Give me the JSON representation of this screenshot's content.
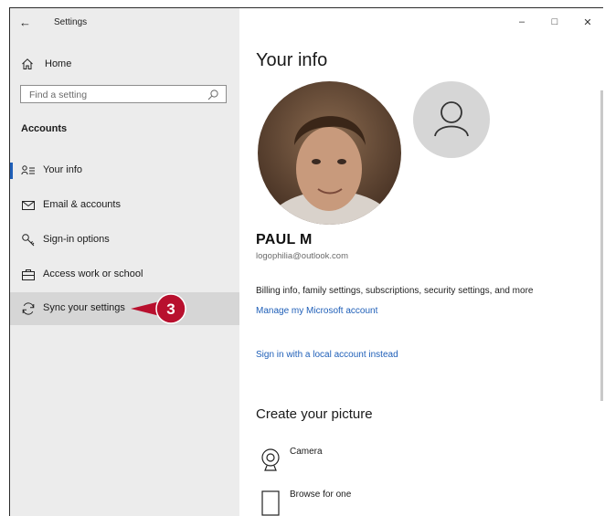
{
  "window": {
    "title": "Settings",
    "back_glyph": "←",
    "minimize_glyph": "–",
    "maximize_glyph": "□",
    "close_glyph": "✕"
  },
  "sidebar": {
    "home_label": "Home",
    "search_placeholder": "Find a setting",
    "section_title": "Accounts",
    "items": [
      {
        "label": "Your info",
        "icon": "person-list-icon",
        "active": true
      },
      {
        "label": "Email & accounts",
        "icon": "envelope-icon"
      },
      {
        "label": "Sign-in options",
        "icon": "key-icon"
      },
      {
        "label": "Access work or school",
        "icon": "briefcase-icon"
      },
      {
        "label": "Sync your settings",
        "icon": "sync-icon",
        "selected": true
      }
    ],
    "callout_number": "3",
    "callout_color": "#b8102e"
  },
  "main": {
    "title": "Your info",
    "user_name": "PAUL M",
    "user_email": "logophilia@outlook.com",
    "billing_text": "Billing info, family settings, subscriptions, security settings, and more",
    "manage_link": "Manage my Microsoft account",
    "local_account_link": "Sign in with a local account instead",
    "create_picture_title": "Create your picture",
    "camera_label": "Camera",
    "browse_label": "Browse for one",
    "accent_color": "#1f5fb8"
  }
}
